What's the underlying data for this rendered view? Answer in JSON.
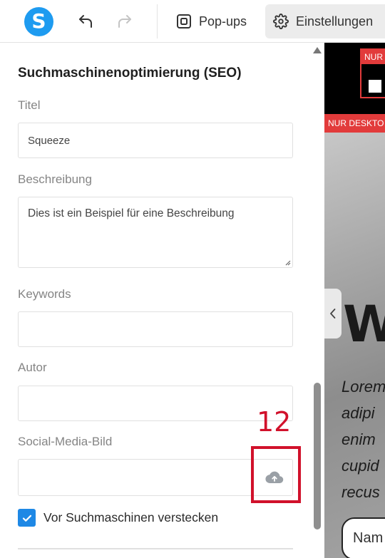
{
  "toolbar": {
    "logo_letter": "S",
    "popups_label": "Pop-ups",
    "settings_label": "Einstellungen"
  },
  "seo": {
    "section_title": "Suchmaschinenoptimierung (SEO)",
    "title_label": "Titel",
    "title_value": "Squeeze",
    "description_label": "Beschreibung",
    "description_value": "Dies ist ein Beispiel für eine Beschreibung",
    "keywords_label": "Keywords",
    "keywords_value": "",
    "author_label": "Autor",
    "author_value": "",
    "social_image_label": "Social-Media-Bild",
    "social_image_value": "",
    "hide_checkbox_label": "Vor Suchmaschinen verstecken",
    "hide_checkbox_checked": true
  },
  "annotation": {
    "number": "12",
    "color": "#d1112b"
  },
  "preview": {
    "tag_top": "NUR",
    "tag_desktop": "NUR DESKTO",
    "headline_fragment": "W",
    "body_lines": [
      "Lorem",
      "adipi",
      "enim",
      "cupid",
      "recus"
    ],
    "input_fragment": "Nam"
  },
  "colors": {
    "accent": "#1e88e5",
    "logo": "#1e9bf0",
    "preview_red": "#e23b3b"
  }
}
